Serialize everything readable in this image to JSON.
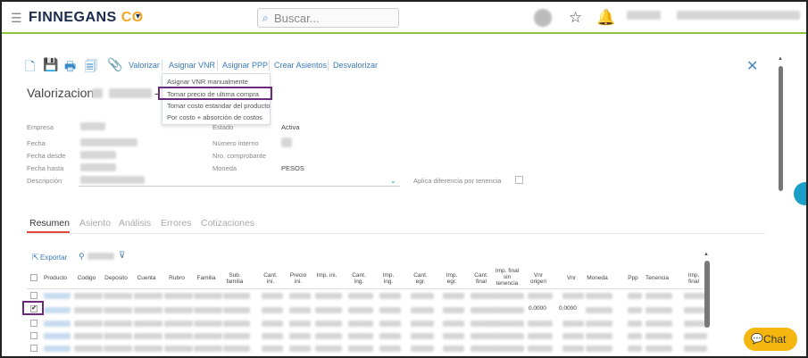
{
  "app": {
    "logo_main": "FINNEGANS",
    "logo_co": "CO",
    "search_placeholder": "Buscar..."
  },
  "toolbar": {
    "links": [
      "Valorizar",
      "Asignar VNR",
      "Asignar PPP",
      "Crear Asientos",
      "Desvalorizar"
    ]
  },
  "dropdown": {
    "items": [
      "Asignar VNR manualmente",
      "Tomar precio de ultima compra",
      "Tomar costo estandar del producto",
      "Por costo + absorción de costos"
    ]
  },
  "form": {
    "title": "Valorizacion",
    "labels": {
      "empresa": "Empresa",
      "fecha": "Fecha",
      "fecha_desde": "Fecha desde",
      "fecha_hasta": "Fecha hasta",
      "descripcion": "Descripción",
      "estado": "Estado",
      "numero_interno": "Número interno",
      "nro_comprobante": "Nro. comprobante",
      "moneda": "Moneda",
      "aplica": "Aplica diferencia por tenencia"
    },
    "values": {
      "estado": "Activa",
      "moneda": "PESOS"
    }
  },
  "tabs": [
    "Resumen",
    "Asiento",
    "Análisis",
    "Errores",
    "Cotizaciones"
  ],
  "grid": {
    "export_label": "Exportar",
    "columns": [
      "Producto",
      "Codigo",
      "Deposito",
      "Cuenta",
      "Rubro",
      "Familia",
      "Sub. familia",
      "Cant. ini.",
      "Precio ini.",
      "Imp. ini.",
      "Cant. ing.",
      "Imp. ing.",
      "Cant. egr.",
      "Imp. egr.",
      "Cant. final",
      "Imp. final sin tenencia",
      "Vnr origen",
      "Vnr",
      "Moneda",
      "Ppp",
      "Tenencia",
      "Imp. final"
    ],
    "row_values": {
      "vnr_origen": "0.0000",
      "vnr": "0.0000"
    }
  },
  "chat": {
    "label": "Chat"
  }
}
